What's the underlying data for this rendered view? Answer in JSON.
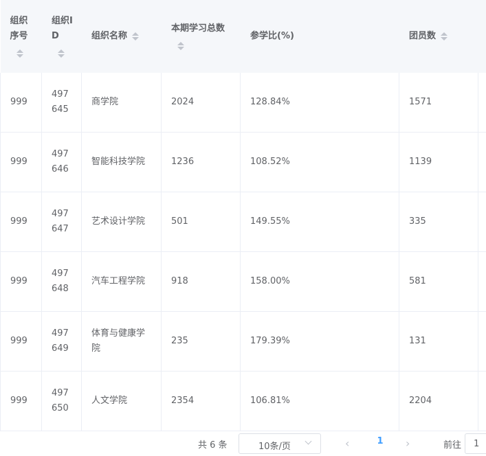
{
  "table": {
    "headers": [
      {
        "label": "组织序号",
        "sortable": true
      },
      {
        "label": "组织ID",
        "sortable": true
      },
      {
        "label": "组织名称",
        "sortable": true
      },
      {
        "label": "本期学习总数",
        "sortable": true
      },
      {
        "label": "参学比(%)",
        "sortable": false
      },
      {
        "label": "团员数",
        "sortable": true
      }
    ],
    "rows": [
      {
        "seq": "999",
        "id": "497645",
        "name": "商学院",
        "total": "2024",
        "ratio": "128.84%",
        "members": "1571"
      },
      {
        "seq": "999",
        "id": "497646",
        "name": "智能科技学院",
        "total": "1236",
        "ratio": "108.52%",
        "members": "1139"
      },
      {
        "seq": "999",
        "id": "497647",
        "name": "艺术设计学院",
        "total": "501",
        "ratio": "149.55%",
        "members": "335"
      },
      {
        "seq": "999",
        "id": "497648",
        "name": "汽车工程学院",
        "total": "918",
        "ratio": "158.00%",
        "members": "581"
      },
      {
        "seq": "999",
        "id": "497649",
        "name": "体育与健康学院",
        "total": "235",
        "ratio": "179.39%",
        "members": "131"
      },
      {
        "seq": "999",
        "id": "497650",
        "name": "人文学院",
        "total": "2354",
        "ratio": "106.81%",
        "members": "2204"
      }
    ]
  },
  "pagination": {
    "total_text": "共 6 条",
    "page_size": "10条/页",
    "current_page": "1",
    "goto_label": "前往",
    "goto_value": "1"
  },
  "colors": {
    "header_bg": "#f5f7fa",
    "border": "#ebeef5",
    "text": "#606266",
    "active_page": "#409eff",
    "sort_icon": "#c0c4cc"
  },
  "icons": {
    "sort": "caret-sort-icon",
    "prev": "chevron-left-icon",
    "next": "chevron-right-icon",
    "dropdown": "chevron-down-icon"
  }
}
